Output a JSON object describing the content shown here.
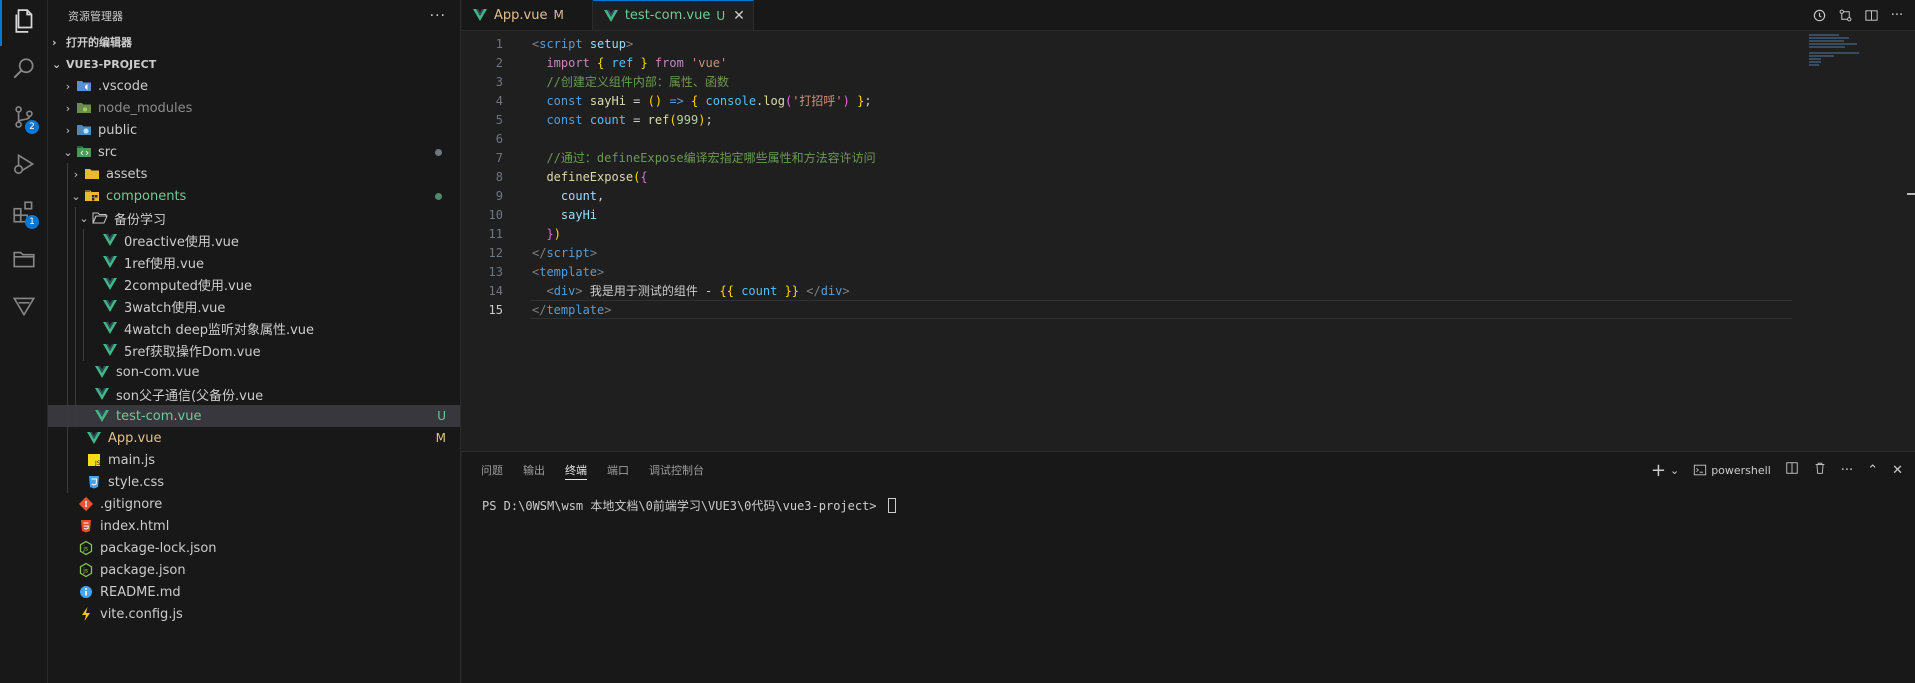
{
  "activity": {
    "items": [
      {
        "name": "explorer",
        "icon": "files-icon"
      },
      {
        "name": "search",
        "icon": "search-icon"
      },
      {
        "name": "scm",
        "icon": "source-control-icon",
        "badge": "2"
      },
      {
        "name": "debug",
        "icon": "run-debug-icon"
      },
      {
        "name": "extensions",
        "icon": "extensions-icon",
        "badge": "1"
      },
      {
        "name": "remote",
        "icon": "folder-icon"
      },
      {
        "name": "other",
        "icon": "triangle-icon"
      }
    ]
  },
  "sidebar": {
    "title": "资源管理器",
    "more": "···",
    "open_editors": "打开的编辑器",
    "project": "VUE3-PROJECT",
    "tree": [
      {
        "label": ".vscode",
        "type": "folder",
        "depth": 0,
        "twisty": "›",
        "color": "#cccccc",
        "icon": "vscode-folder-icon"
      },
      {
        "label": "node_modules",
        "type": "folder",
        "depth": 0,
        "twisty": "›",
        "color": "#8b8b8b",
        "icon": "node-folder-icon"
      },
      {
        "label": "public",
        "type": "folder",
        "depth": 0,
        "twisty": "›",
        "color": "#cccccc",
        "icon": "public-folder-icon"
      },
      {
        "label": "src",
        "type": "folder",
        "depth": 0,
        "twisty": "⌄",
        "color": "#cccccc",
        "icon": "src-folder-icon",
        "dot": "#6e7681"
      },
      {
        "label": "assets",
        "type": "folder",
        "depth": 1,
        "twisty": "›",
        "color": "#cccccc",
        "icon": "assets-folder-icon"
      },
      {
        "label": "components",
        "type": "folder",
        "depth": 1,
        "twisty": "⌄",
        "color": "#73c991",
        "icon": "components-folder-icon",
        "dot": "#4e8a6e"
      },
      {
        "label": "备份学习",
        "type": "folder",
        "depth": 2,
        "twisty": "⌄",
        "color": "#cccccc",
        "icon": "open-folder-icon"
      },
      {
        "label": "0reactive使用.vue",
        "type": "vue",
        "depth": 3,
        "color": "#cccccc",
        "icon": "vue-file-icon"
      },
      {
        "label": "1ref使用.vue",
        "type": "vue",
        "depth": 3,
        "color": "#cccccc",
        "icon": "vue-file-icon"
      },
      {
        "label": "2computed使用.vue",
        "type": "vue",
        "depth": 3,
        "color": "#cccccc",
        "icon": "vue-file-icon"
      },
      {
        "label": "3watch使用.vue",
        "type": "vue",
        "depth": 3,
        "color": "#cccccc",
        "icon": "vue-file-icon"
      },
      {
        "label": "4watch deep监听对象属性.vue",
        "type": "vue",
        "depth": 3,
        "color": "#cccccc",
        "icon": "vue-file-icon"
      },
      {
        "label": "5ref获取操作Dom.vue",
        "type": "vue",
        "depth": 3,
        "color": "#cccccc",
        "icon": "vue-file-icon"
      },
      {
        "label": "son-com.vue",
        "type": "vue",
        "depth": 2,
        "color": "#cccccc",
        "icon": "vue-file-icon"
      },
      {
        "label": "son父子通信(父备份.vue",
        "type": "vue",
        "depth": 2,
        "color": "#cccccc",
        "icon": "vue-file-icon"
      },
      {
        "label": "test-com.vue",
        "type": "vue",
        "depth": 2,
        "color": "#73c991",
        "icon": "vue-file-icon",
        "deco": "U",
        "deco_color": "#73c991",
        "selected": true
      },
      {
        "label": "App.vue",
        "type": "vue",
        "depth": 1,
        "color": "#e2c08d",
        "icon": "vue-file-icon",
        "deco": "M",
        "deco_color": "#e2c08d"
      },
      {
        "label": "main.js",
        "type": "js",
        "depth": 1,
        "color": "#cccccc",
        "icon": "js-file-icon"
      },
      {
        "label": "style.css",
        "type": "css",
        "depth": 1,
        "color": "#cccccc",
        "icon": "css-file-icon"
      },
      {
        "label": ".gitignore",
        "type": "git",
        "depth": 0,
        "color": "#cccccc",
        "icon": "git-file-icon"
      },
      {
        "label": "index.html",
        "type": "html",
        "depth": 0,
        "color": "#cccccc",
        "icon": "html-file-icon"
      },
      {
        "label": "package-lock.json",
        "type": "json",
        "depth": 0,
        "color": "#cccccc",
        "icon": "node-json-icon"
      },
      {
        "label": "package.json",
        "type": "json",
        "depth": 0,
        "color": "#cccccc",
        "icon": "node-json-icon"
      },
      {
        "label": "README.md",
        "type": "md",
        "depth": 0,
        "color": "#cccccc",
        "icon": "info-file-icon"
      },
      {
        "label": "vite.config.js",
        "type": "vite",
        "depth": 0,
        "color": "#cccccc",
        "icon": "vite-file-icon"
      }
    ]
  },
  "tabs": [
    {
      "label": "App.vue",
      "mark": "M",
      "label_color": "#e2c08d",
      "active": false
    },
    {
      "label": "test-com.vue",
      "mark": "U",
      "label_color": "#73c991",
      "active": true,
      "close": "✕"
    }
  ],
  "editor": {
    "current_line": 15,
    "lines": [
      [
        [
          "t-tag",
          "<"
        ],
        [
          "t-tn",
          "script"
        ],
        [
          "",
          " "
        ],
        [
          "t-attr",
          "setup"
        ],
        [
          "t-tag",
          ">"
        ]
      ],
      [
        [
          "",
          "  "
        ],
        [
          "t-kw",
          "import"
        ],
        [
          "",
          " "
        ],
        [
          "t-b1",
          "{"
        ],
        [
          "",
          " "
        ],
        [
          "t-var",
          "ref"
        ],
        [
          "",
          " "
        ],
        [
          "t-b1",
          "}"
        ],
        [
          "",
          " "
        ],
        [
          "t-kw",
          "from"
        ],
        [
          "",
          " "
        ],
        [
          "t-str",
          "'vue'"
        ]
      ],
      [
        [
          "",
          "  "
        ],
        [
          "t-cm",
          "//创建定义组件内部：属性、函数"
        ]
      ],
      [
        [
          "",
          "  "
        ],
        [
          "t-kw2",
          "const"
        ],
        [
          "",
          " "
        ],
        [
          "t-fn",
          "sayHi"
        ],
        [
          "",
          " = "
        ],
        [
          "t-b1",
          "()"
        ],
        [
          "",
          " "
        ],
        [
          "t-kw2",
          "=>"
        ],
        [
          "",
          " "
        ],
        [
          "t-b1",
          "{"
        ],
        [
          "",
          " "
        ],
        [
          "t-var",
          "console"
        ],
        [
          "",
          "."
        ],
        [
          "t-fn",
          "log"
        ],
        [
          "t-b2",
          "("
        ],
        [
          "t-str",
          "'打招呼'"
        ],
        [
          "t-b2",
          ")"
        ],
        [
          "",
          " "
        ],
        [
          "t-b1",
          "}"
        ],
        [
          "",
          ";"
        ]
      ],
      [
        [
          "",
          "  "
        ],
        [
          "t-kw2",
          "const"
        ],
        [
          "",
          " "
        ],
        [
          "t-var",
          "count"
        ],
        [
          "",
          " = "
        ],
        [
          "t-fn",
          "ref"
        ],
        [
          "t-b1",
          "("
        ],
        [
          "t-num",
          "999"
        ],
        [
          "t-b1",
          ")"
        ],
        [
          "",
          ";"
        ]
      ],
      [
        [
          "",
          ""
        ]
      ],
      [
        [
          "",
          "  "
        ],
        [
          "t-cm",
          "//通过：defineExpose编译宏指定哪些属性和方法容许访问"
        ]
      ],
      [
        [
          "",
          "  "
        ],
        [
          "t-fn",
          "defineExpose"
        ],
        [
          "t-b1",
          "("
        ],
        [
          "t-b2",
          "{"
        ]
      ],
      [
        [
          "",
          "    "
        ],
        [
          "t-prop",
          "count"
        ],
        [
          "",
          ","
        ]
      ],
      [
        [
          "",
          "    "
        ],
        [
          "t-prop",
          "sayHi"
        ]
      ],
      [
        [
          "",
          "  "
        ],
        [
          "t-b2",
          "}"
        ],
        [
          "t-b1",
          ")"
        ]
      ],
      [
        [
          "t-tag",
          "</"
        ],
        [
          "t-tn",
          "script"
        ],
        [
          "t-tag",
          ">"
        ]
      ],
      [
        [
          "t-tag",
          "<"
        ],
        [
          "t-tn",
          "template"
        ],
        [
          "t-tag",
          ">"
        ]
      ],
      [
        [
          "",
          "  "
        ],
        [
          "t-tag",
          "<"
        ],
        [
          "t-tn",
          "div"
        ],
        [
          "t-tag",
          ">"
        ],
        [
          "",
          " 我是用于测试的组件 - "
        ],
        [
          "t-b1",
          "{{"
        ],
        [
          "",
          " "
        ],
        [
          "t-var",
          "count"
        ],
        [
          "",
          " "
        ],
        [
          "t-b1",
          "}}"
        ],
        [
          "",
          " "
        ],
        [
          "t-tag",
          "</"
        ],
        [
          "t-tn",
          "div"
        ],
        [
          "t-tag",
          ">"
        ]
      ],
      [
        [
          "t-tag",
          "</"
        ],
        [
          "t-tn",
          "template"
        ],
        [
          "t-tag",
          ">"
        ]
      ]
    ]
  },
  "panel": {
    "tabs": [
      "问题",
      "输出",
      "终端",
      "端口",
      "调试控制台"
    ],
    "active_tab": 2,
    "shell_label": "powershell",
    "terminal_line": "PS D:\\0WSM\\wsm 本地文档\\0前端学习\\VUE3\\0代码\\vue3-project> "
  }
}
